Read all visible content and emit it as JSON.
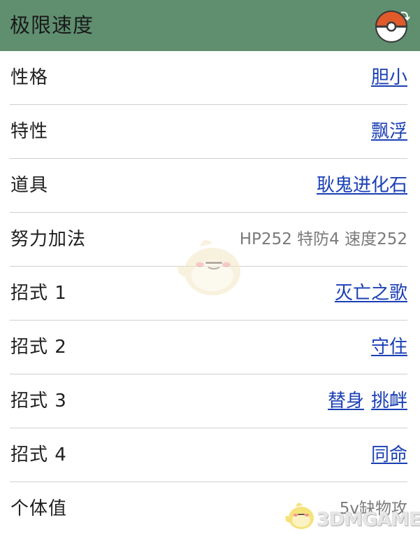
{
  "header": {
    "title": "极限速度",
    "icon": "pokeball-icon",
    "accent_color": "#5f8f6f"
  },
  "rows": [
    {
      "label": "性格",
      "values": [
        "胆小"
      ]
    },
    {
      "label": "特性",
      "values": [
        "飘浮"
      ]
    },
    {
      "label": "道具",
      "values": [
        "耿鬼进化石"
      ]
    },
    {
      "label": "努力加法",
      "text": "HP252 特防4 速度252"
    },
    {
      "label": "招式 1",
      "values": [
        "灭亡之歌"
      ]
    },
    {
      "label": "招式 2",
      "values": [
        "守住"
      ]
    },
    {
      "label": "招式 3",
      "values": [
        "替身",
        "挑衅"
      ]
    },
    {
      "label": "招式 4",
      "values": [
        "同命"
      ]
    },
    {
      "label": "个体值",
      "text": "5v缺物攻"
    }
  ],
  "watermark": {
    "logo_text": "3DMGAME"
  },
  "colors": {
    "link": "#1a3fb5",
    "divider": "#cfcfcf",
    "plain_value": "#7a7a7a"
  }
}
